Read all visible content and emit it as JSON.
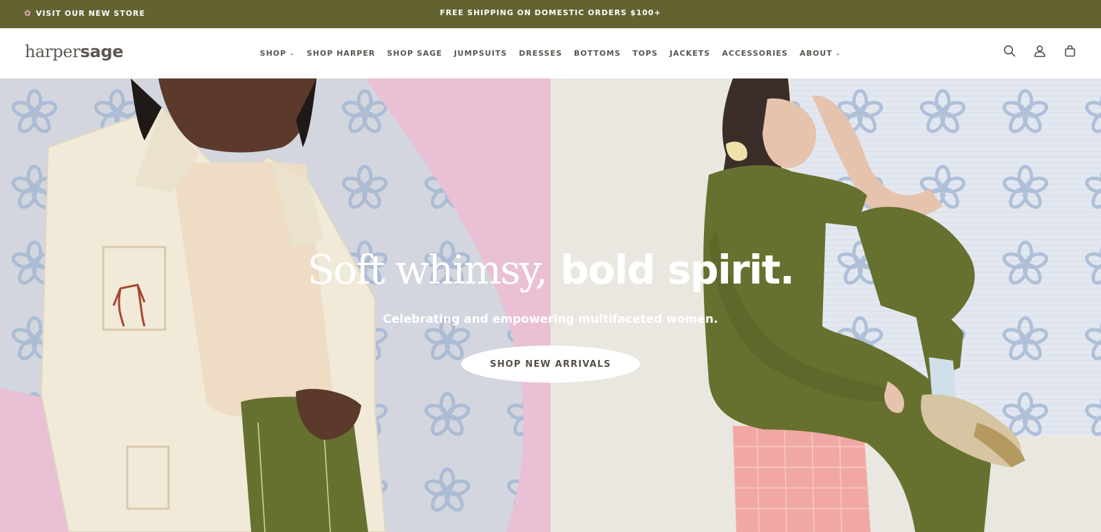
{
  "announcement": {
    "left_icon": "flower-icon",
    "left_text": "VISIT OUR NEW STORE",
    "center_text": "FREE SHIPPING ON DOMESTIC ORDERS $100+",
    "background": "#636332"
  },
  "header": {
    "logo_light": "harper",
    "logo_bold": "sage",
    "nav": [
      {
        "label": "SHOP",
        "dropdown": true
      },
      {
        "label": "SHOP HARPER",
        "dropdown": false
      },
      {
        "label": "SHOP SAGE",
        "dropdown": false
      },
      {
        "label": "JUMPSUITS",
        "dropdown": false
      },
      {
        "label": "DRESSES",
        "dropdown": false
      },
      {
        "label": "BOTTOMS",
        "dropdown": false
      },
      {
        "label": "TOPS",
        "dropdown": false
      },
      {
        "label": "JACKETS",
        "dropdown": false
      },
      {
        "label": "ACCESSORIES",
        "dropdown": false
      },
      {
        "label": "ABOUT",
        "dropdown": true
      }
    ],
    "icons": [
      "search-icon",
      "account-icon",
      "cart-icon"
    ]
  },
  "hero": {
    "headline_light": "Soft whimsy,",
    "headline_bold": "bold spirit.",
    "subheadline": "Celebrating and empowering multifaceted women.",
    "cta_label": "SHOP NEW ARRIVALS",
    "colors": {
      "pink": "#e9c0d4",
      "left_backdrop": "#d4d8e0",
      "right_backdrop": "#e9e7df",
      "olive": "#66712f",
      "cream": "#f1ead9"
    }
  }
}
